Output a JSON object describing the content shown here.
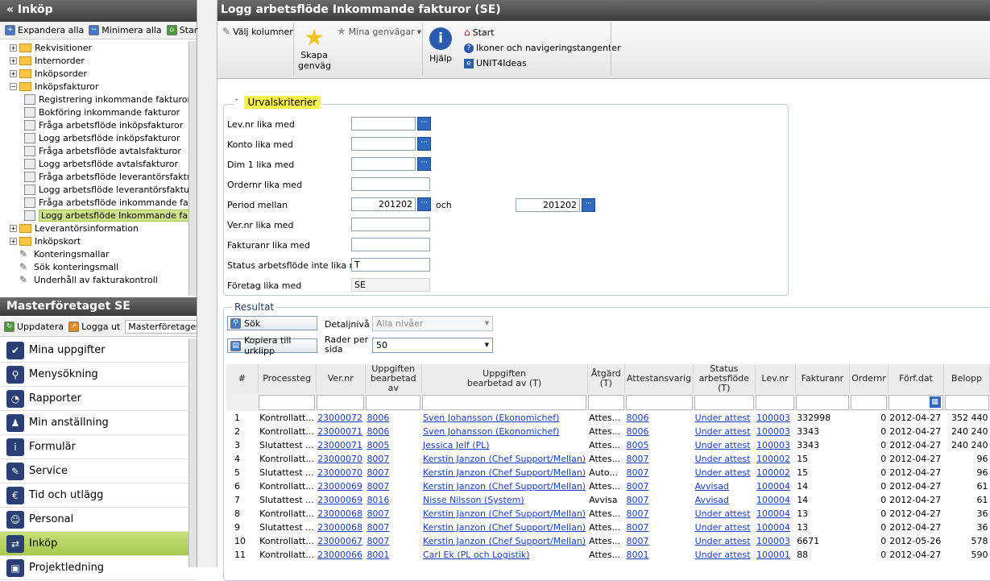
{
  "left_panel": {
    "title": "« Inköp",
    "toolbar": {
      "expand": "Expandera alla",
      "collapse": "Minimera alla",
      "start": "Start"
    },
    "tree": [
      {
        "label": "Rekvisitioner",
        "kind": "folder",
        "exp": "+",
        "indent": 0
      },
      {
        "label": "Internorder",
        "kind": "folder",
        "exp": "+",
        "indent": 0
      },
      {
        "label": "Inköpsorder",
        "kind": "folder",
        "exp": "+",
        "indent": 0
      },
      {
        "label": "Inköpsfakturor",
        "kind": "folder",
        "exp": "−",
        "indent": 0
      },
      {
        "label": "Registrering inkommande fakturor",
        "kind": "leaf",
        "indent": 1
      },
      {
        "label": "Bokföring inkommande fakturor",
        "kind": "leaf",
        "indent": 1
      },
      {
        "label": "Fråga arbetsflöde inköpsfakturor",
        "kind": "leaf",
        "indent": 1
      },
      {
        "label": "Logg arbetsflöde inköpsfakturor",
        "kind": "leaf",
        "indent": 1
      },
      {
        "label": "Fråga arbetsflöde avtalsfakturor",
        "kind": "leaf",
        "indent": 1
      },
      {
        "label": "Logg arbetsflöde avtalsfakturor",
        "kind": "leaf",
        "indent": 1
      },
      {
        "label": "Fråga arbetsflöde leverantörsfakturor",
        "kind": "leaf",
        "indent": 1
      },
      {
        "label": "Logg arbetsflöde leverantörsfakturor",
        "kind": "leaf",
        "indent": 1
      },
      {
        "label": "Fråga arbetsflöde inkommande fakturor",
        "kind": "leaf",
        "indent": 1
      },
      {
        "label": "Logg arbetsflöde Inkommande fakturor",
        "kind": "leaf",
        "indent": 1,
        "selected": true
      },
      {
        "label": "Leverantörsinformation",
        "kind": "folder",
        "exp": "+",
        "indent": 0
      },
      {
        "label": "Inköpskort",
        "kind": "folder",
        "exp": "+",
        "indent": 0
      },
      {
        "label": "Konteringsmallar",
        "kind": "tool",
        "indent": 0
      },
      {
        "label": "Sök konteringsmall",
        "kind": "tool",
        "indent": 0
      },
      {
        "label": "Underhåll av fakturakontroll",
        "kind": "tool",
        "indent": 0
      }
    ],
    "company_section": "Masterföretaget SE",
    "toolbar2": {
      "refresh": "Uppdatera",
      "logout": "Logga ut",
      "company": "Masterföretaget SE"
    },
    "nav": [
      "Mina uppgifter",
      "Menysökning",
      "Rapporter",
      "Min anställning",
      "Formulär",
      "Service",
      "Tid och utlägg",
      "Personal",
      "Inköp",
      "Projektledning"
    ],
    "nav_active": "Inköp"
  },
  "main": {
    "title": "Logg arbetsflöde Inkommande fakturor (SE)",
    "ribbon": {
      "choose_columns": "Välj kolumner",
      "create_shortcut": "Skapa\ngenväg",
      "my_shortcuts": "Mina genvägar",
      "help": "Hjälp",
      "start": "Start",
      "icons": "Ikoner och navigeringstangenter",
      "ideas": "UNIT4Ideas"
    },
    "criteria": {
      "title": "Urvalskriterier",
      "fields": [
        {
          "label": "Lev.nr lika med",
          "value": "",
          "lookup": true
        },
        {
          "label": "Konto lika med",
          "value": "",
          "lookup": true
        },
        {
          "label": "Dim 1 lika med",
          "value": "",
          "lookup": true
        },
        {
          "label": "Ordernr lika med",
          "value": "",
          "lookup": false
        },
        {
          "label": "Period mellan",
          "value": "201202",
          "lookup": true
        },
        {
          "label": "Ver.nr lika med",
          "value": "",
          "lookup": false
        },
        {
          "label": "Fakturanr lika med",
          "value": "",
          "lookup": false
        },
        {
          "label": "Status arbetsflöde inte lika med",
          "value": "T",
          "lookup": false
        },
        {
          "label": "Företag lika med",
          "value": "SE",
          "lookup": false,
          "readonly": true
        }
      ],
      "and_label": "och",
      "period_to": "201202"
    },
    "results": {
      "title": "Resultat",
      "search": "Sök",
      "copy": "Kopiera till urklipp",
      "detail_label": "Detaljnivå",
      "detail_value": "Alla nivåer",
      "rows_label": "Rader per\nsida",
      "rows_value": "50"
    },
    "columns": [
      "#",
      "Processteg",
      "Ver.nr",
      "Uppgiften\nbearbetad av",
      "Uppgiften\nbearbetad av (T)",
      "Åtgärd\n(T)",
      "Attestansvarig",
      "Status\narbetsflöde (T)",
      "Lev.nr",
      "Fakturanr",
      "Ordernr",
      "Förf.dat",
      "Belopp"
    ],
    "rows": [
      [
        "1",
        "Kontrollatt...",
        "23000072",
        "8006",
        "Sven Johansson (Ekonomichef)",
        "Attes...",
        "8006",
        "Under attest",
        "100003",
        "332998",
        "0",
        "2012-04-27",
        "352 440"
      ],
      [
        "2",
        "Kontrollatt...",
        "23000071",
        "8006",
        "Sven Johansson (Ekonomichef)",
        "Attes...",
        "8006",
        "Under attest",
        "100003",
        "3343",
        "0",
        "2012-04-27",
        "240 240"
      ],
      [
        "3",
        "Slutattest ...",
        "23000071",
        "8005",
        "Jessica Jelf (PL)",
        "Attes...",
        "8005",
        "Under attest",
        "100003",
        "3343",
        "0",
        "2012-04-27",
        "240 240"
      ],
      [
        "4",
        "Kontrollatt...",
        "23000070",
        "8007",
        "Kerstin Janzon (Chef Support/Mellan)",
        "Attes...",
        "8007",
        "Under attest",
        "100002",
        "15",
        "0",
        "2012-04-27",
        "96"
      ],
      [
        "5",
        "Slutattest ...",
        "23000070",
        "8007",
        "Kerstin Janzon (Chef Support/Mellan)",
        "Auto...",
        "8007",
        "Under attest",
        "100002",
        "15",
        "0",
        "2012-04-27",
        "96"
      ],
      [
        "6",
        "Kontrollatt...",
        "23000069",
        "8007",
        "Kerstin Janzon (Chef Support/Mellan)",
        "Attes...",
        "8007",
        "Avvisad",
        "100004",
        "14",
        "0",
        "2012-04-27",
        "61"
      ],
      [
        "7",
        "Slutattest ...",
        "23000069",
        "8016",
        "Nisse Nilsson (System)",
        "Avvisa",
        "8007",
        "Avvisad",
        "100004",
        "14",
        "0",
        "2012-04-27",
        "61"
      ],
      [
        "8",
        "Kontrollatt...",
        "23000068",
        "8007",
        "Kerstin Janzon (Chef Support/Mellan)",
        "Attes...",
        "8007",
        "Under attest",
        "100004",
        "13",
        "0",
        "2012-04-27",
        "36"
      ],
      [
        "9",
        "Slutattest ...",
        "23000068",
        "8007",
        "Kerstin Janzon (Chef Support/Mellan)",
        "Attes...",
        "8007",
        "Under attest",
        "100004",
        "13",
        "0",
        "2012-04-27",
        "36"
      ],
      [
        "10",
        "Kontrollatt...",
        "23000067",
        "8007",
        "Kerstin Janzon (Chef Support/Mellan)",
        "Attes...",
        "8007",
        "Under attest",
        "100003",
        "6671",
        "0",
        "2012-05-26",
        "578"
      ],
      [
        "11",
        "Kontrollatt...",
        "23000066",
        "8001",
        "Carl Ek (PL och Logistik)",
        "Attes...",
        "8001",
        "Under attest",
        "100001",
        "88",
        "0",
        "2012-04-27",
        "590"
      ]
    ]
  }
}
